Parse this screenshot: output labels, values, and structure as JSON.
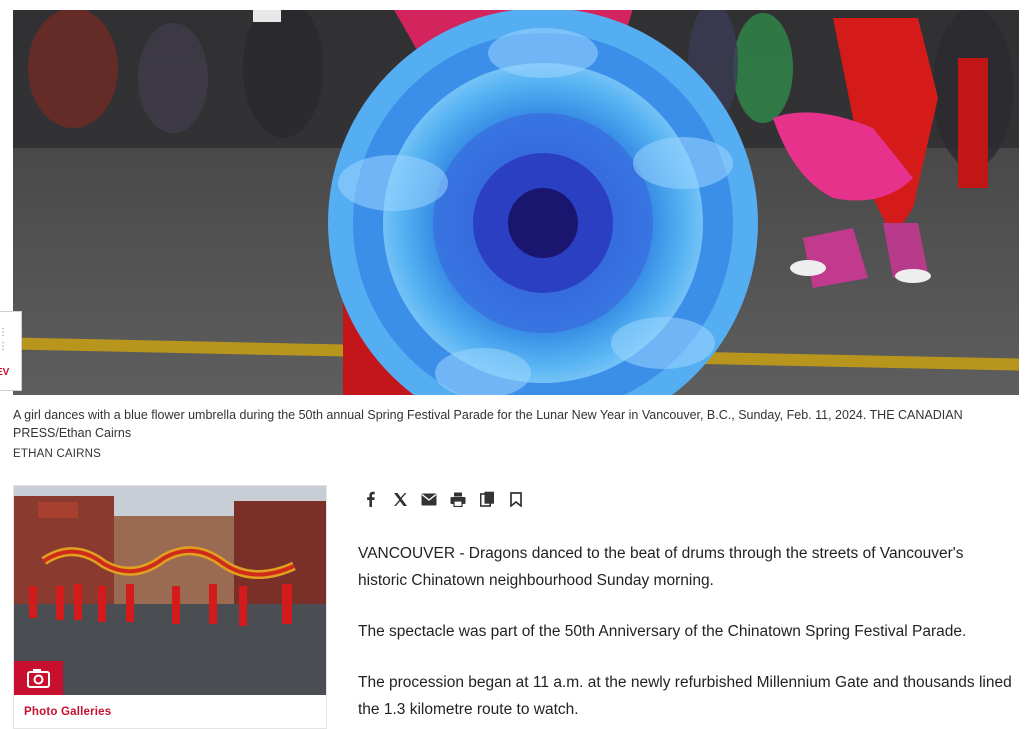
{
  "hero": {
    "prev_label": "EV"
  },
  "caption": {
    "text": "A girl dances with a blue flower umbrella during the 50th annual Spring Festival Parade for the Lunar New Year in Vancouver, B.C., Sunday, Feb. 11, 2024. THE CANADIAN PRESS/Ethan Cairns",
    "credit": "ETHAN CAIRNS"
  },
  "gallery": {
    "label": "Photo Galleries",
    "badge_icon": "camera-icon"
  },
  "share": {
    "icons": [
      "facebook-icon",
      "x-icon",
      "email-icon",
      "print-icon",
      "copy-icon",
      "bookmark-icon"
    ]
  },
  "article": {
    "paragraphs": [
      "VANCOUVER - Dragons danced to the beat of drums through the streets of Vancouver's historic Chinatown neighbourhood Sunday morning.",
      "The spectacle was part of the 50th Anniversary of the Chinatown Spring Festival Parade.",
      "The procession began at 11 a.m. at the newly refurbished Millennium Gate and thousands lined the 1.3 kilometre route to watch."
    ]
  },
  "colors": {
    "accent": "#c8102e",
    "text": "#222222"
  }
}
